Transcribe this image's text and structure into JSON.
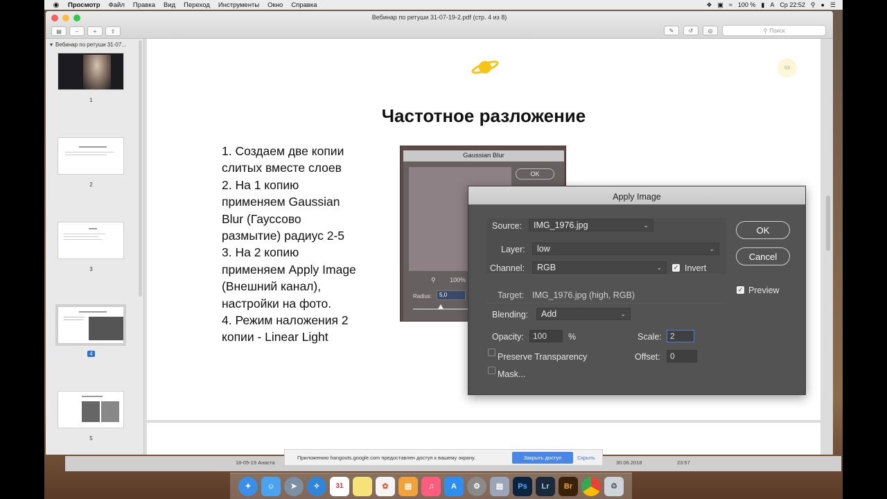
{
  "menubar": {
    "apple": "",
    "items": [
      "Просмотр",
      "Файл",
      "Правка",
      "Вид",
      "Переход",
      "Инструменты",
      "Окно",
      "Справка"
    ],
    "battery": "100 %",
    "input_lang": "A",
    "clock": "Ср 22:52"
  },
  "window": {
    "title": "Вебинар по ретуши 31-07-19-2.pdf (стр. 4 из 8)",
    "search_placeholder": "Поиск"
  },
  "sidebar": {
    "doc_name": "Вебинар по ретуши 31-07...",
    "pages": [
      "1",
      "2",
      "3",
      "4",
      "5"
    ],
    "selected_page": "4"
  },
  "slide": {
    "page_badge": "03",
    "title": "Частотное разложение",
    "text": "1. Создаем две копии\nслитых вместе слоев\n2. На 1 копию\nприменяем Gaussian\nBlur (Гауссово\nразмытие) радиус 2-5\n3. На 2 копию\nприменяем Apply Image\n(Внешний канал),\nнастройки на фото.\n4. Режим наложения 2\nкопии - Linear Light"
  },
  "gaussian_blur": {
    "title": "Gaussian Blur",
    "ok": "OK",
    "zoom": "100%",
    "radius_label": "Radius:",
    "radius_value": "5,0"
  },
  "apply_image": {
    "title": "Apply Image",
    "source_label": "Source:",
    "source_value": "IMG_1976.jpg",
    "layer_label": "Layer:",
    "layer_value": "low",
    "channel_label": "Channel:",
    "channel_value": "RGB",
    "invert_label": "Invert",
    "target_label": "Target:",
    "target_value": "IMG_1976.jpg (high, RGB)",
    "blending_label": "Blending:",
    "blending_value": "Add",
    "opacity_label": "Opacity:",
    "opacity_value": "100",
    "opacity_unit": "%",
    "scale_label": "Scale:",
    "scale_value": "2",
    "preserve_label": "Preserve Transparency",
    "offset_label": "Offset:",
    "offset_value": "0",
    "mask_label": "Mask...",
    "ok": "OK",
    "cancel": "Cancel",
    "preview_label": "Preview"
  },
  "notification": {
    "text": "Приложению hangouts.google.com предоставлен доступ к вашему экрану.",
    "stop_button": "Закрыть доступ",
    "hide_link": "Скрыть"
  },
  "background_window": {
    "item": "18-05-19 Анаста",
    "date": "30.06.2018",
    "time": "23:57"
  },
  "dock": {
    "calendar_day": "31",
    "apps": [
      "Ps",
      "Lr",
      "Br"
    ]
  }
}
